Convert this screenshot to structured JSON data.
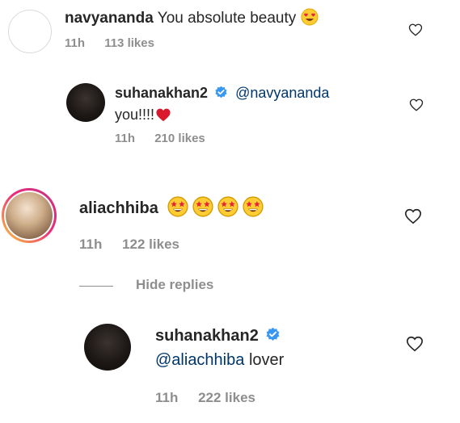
{
  "comments": [
    {
      "username": "navyananda",
      "text": "You absolute beauty",
      "emoji": "heart-eyes-emoji",
      "time": "11h",
      "likes": "113 likes"
    },
    {
      "username": "suhanakhan2",
      "mention": "@navyananda",
      "text": "you!!!!",
      "emoji": "red-heart-emoji",
      "time": "11h",
      "likes": "210 likes"
    },
    {
      "username": "aliachhiba",
      "emoji": "star-struck-emoji",
      "emoji_count": 4,
      "time": "11h",
      "likes": "122 likes"
    },
    {
      "username": "suhanakhan2",
      "mention": "@aliachhiba",
      "text": "lover",
      "time": "11h",
      "likes": "222 likes"
    }
  ],
  "replies_toggle": {
    "label": "Hide replies"
  },
  "colors": {
    "text": "#262626",
    "meta": "#8e8e8e",
    "mention": "#00376b",
    "verified": "#3897f0",
    "heart": "#ed4956"
  }
}
